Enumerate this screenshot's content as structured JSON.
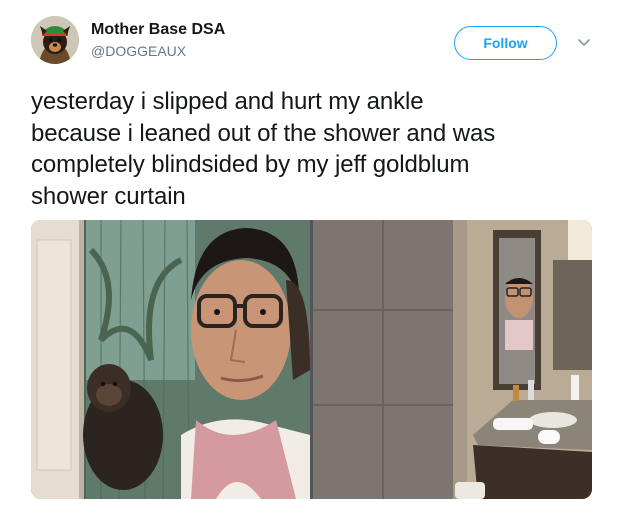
{
  "author": {
    "display_name": "Mother Base DSA",
    "handle": "@DOGGEAUX",
    "avatar_icon": "dog-avatar-icon"
  },
  "actions": {
    "follow_label": "Follow",
    "more_icon": "chevron-down-icon"
  },
  "tweet": {
    "lines": [
      "yesterday i slipped and hurt my ankle",
      "because i leaned out of the shower and was",
      "completely blindsided by my jeff goldblum",
      "shower curtain"
    ]
  },
  "media": {
    "photos": [
      {
        "icon": "shower-curtain-photo"
      },
      {
        "icon": "bathroom-mirror-photo"
      }
    ]
  },
  "colors": {
    "accent": "#1da1f2",
    "text": "#14171a",
    "muted": "#657786"
  }
}
